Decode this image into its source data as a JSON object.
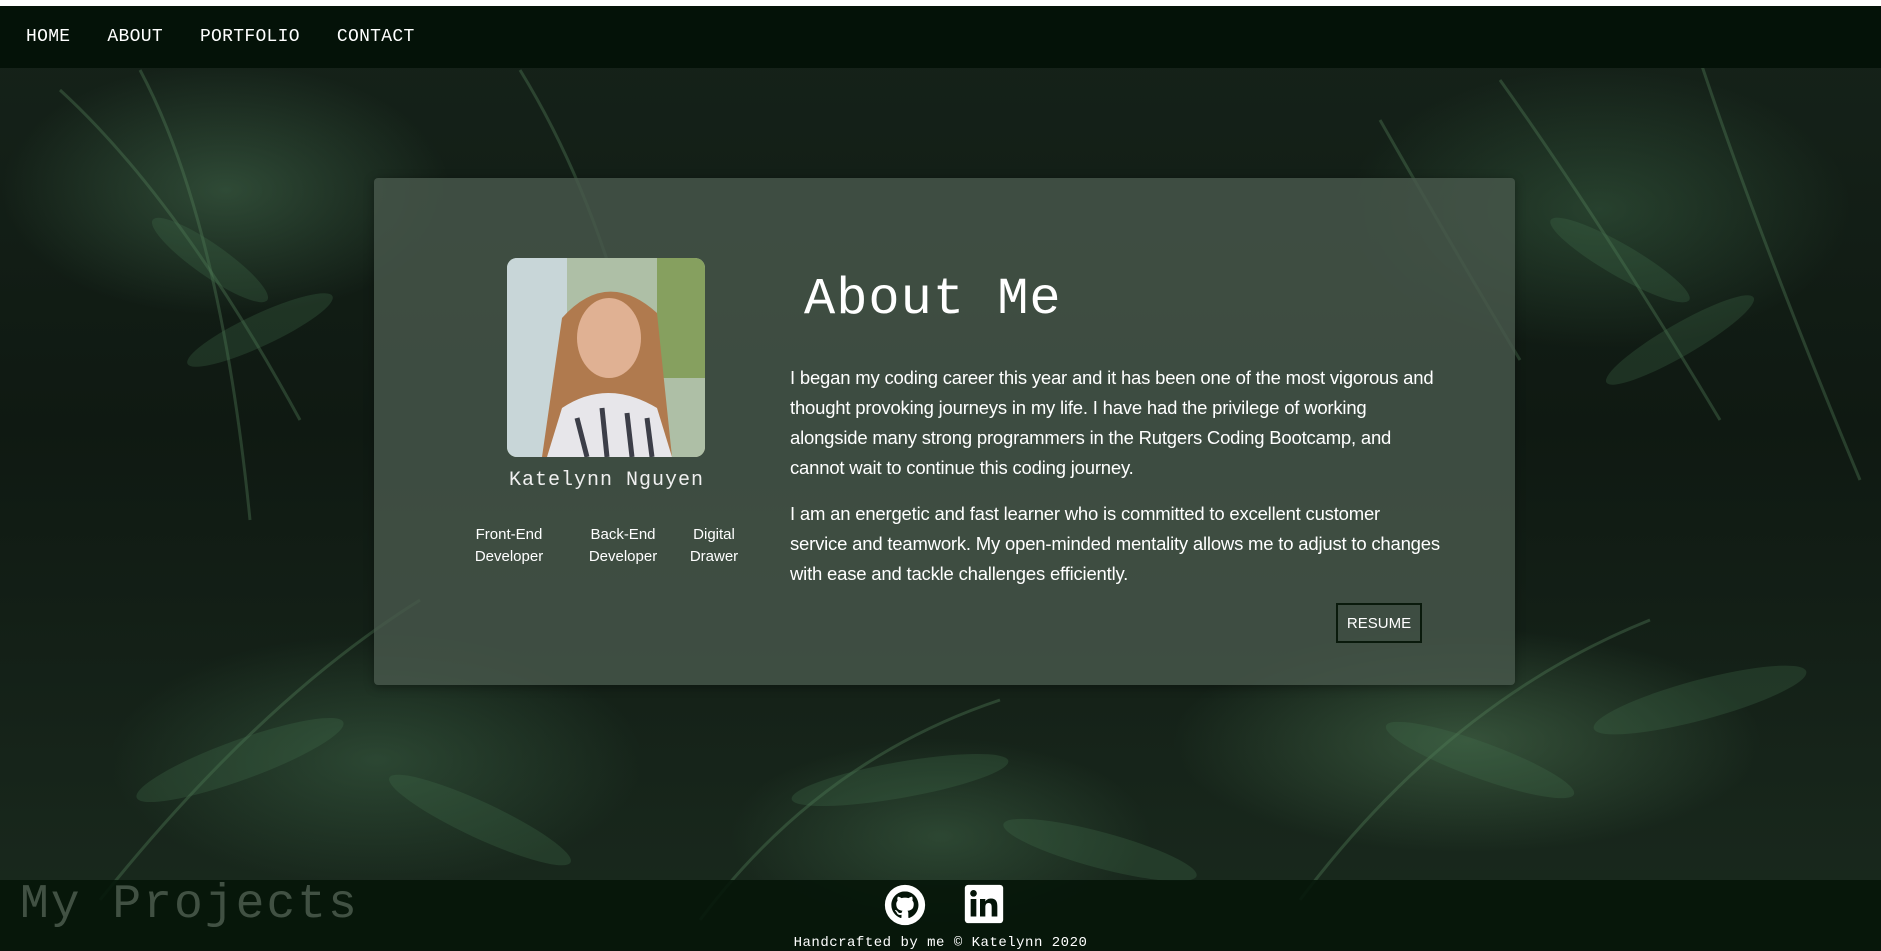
{
  "nav": {
    "items": [
      {
        "label": "HOME"
      },
      {
        "label": "ABOUT"
      },
      {
        "label": "PORTFOLIO"
      },
      {
        "label": "CONTACT"
      }
    ]
  },
  "profile": {
    "name": "Katelynn Nguyen",
    "skills": [
      {
        "line1": "Front-End",
        "line2": "Developer"
      },
      {
        "line1": "Back-End",
        "line2": "Developer"
      },
      {
        "line1": "Digital",
        "line2": "Drawer"
      }
    ]
  },
  "about": {
    "title": "About Me",
    "paragraphs": [
      "I began my coding career this year and it has been one of the most vigorous and thought provoking journeys in my life. I have had the privilege of working alongside many strong programmers in the Rutgers Coding Bootcamp, and cannot wait to continue this coding journey.",
      "I am an energetic and fast learner who is committed to excellent customer service and teamwork. My open-minded mentality allows me to adjust to changes with ease and tackle challenges efficiently."
    ],
    "resume_label": "RESUME"
  },
  "projects": {
    "heading": "My Projects"
  },
  "footer": {
    "icons": [
      "github-icon",
      "linkedin-icon"
    ],
    "copyright": "Handcrafted by me © Katelynn 2020"
  },
  "colors": {
    "navbar": "#041208",
    "card": "#48584c",
    "footer": "#041408"
  }
}
